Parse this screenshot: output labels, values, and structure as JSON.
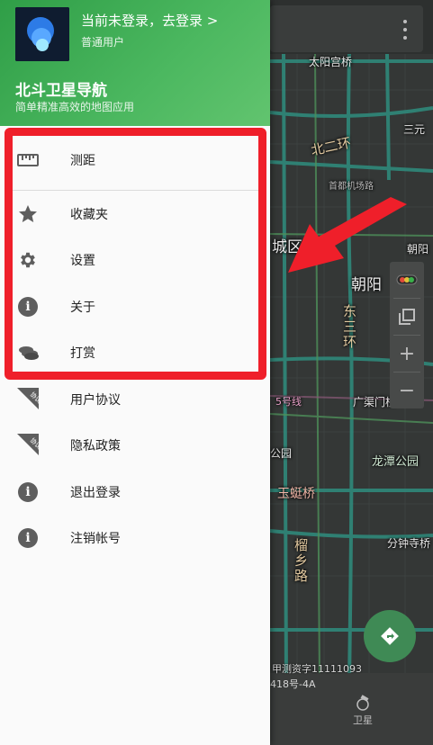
{
  "header": {
    "login_prompt": "当前未登录，去登录 >",
    "user_level": "普通用户",
    "app_name": "北斗卫星导航",
    "app_desc": "简单精准高效的地图应用"
  },
  "menu": {
    "items": [
      {
        "label": "测距",
        "icon": "ruler-icon"
      },
      {
        "label": "收藏夹",
        "icon": "star-icon"
      },
      {
        "label": "设置",
        "icon": "gear-icon"
      },
      {
        "label": "关于",
        "icon": "info-icon"
      },
      {
        "label": "打赏",
        "icon": "coins-icon"
      },
      {
        "label": "用户协议",
        "icon": "agreement-flag-icon",
        "badge": "协议"
      },
      {
        "label": "隐私政策",
        "icon": "privacy-flag-icon",
        "badge": "协议"
      },
      {
        "label": "退出登录",
        "icon": "info-icon"
      },
      {
        "label": "注销帐号",
        "icon": "info-icon"
      }
    ]
  },
  "map": {
    "labels": {
      "taiyanggong": "太阳宫桥",
      "sanyuan": "三元",
      "beiyihuan": "北二环",
      "airport": "首都机场路",
      "chengqu": "城区",
      "chaoyang": "朝阳",
      "chaoyang_small": "朝阳",
      "dongsanhuan": "东三环",
      "guangqumen": "广渠门桥",
      "line5": "5号线",
      "longtan": "龙潭公园",
      "yuting": "玉蜓桥",
      "liuxiang": "榴乡路",
      "fenzhongsi": "分钟寺桥",
      "yuan": "公园"
    },
    "copyright": "甲测资字11111093",
    "copyright2": "418号-4A",
    "sat_tab": "卫星"
  },
  "colors": {
    "drawer_header_start": "#2f9e47",
    "drawer_header_end": "#62c46f",
    "highlight": "#ef1f2a",
    "icon_gray": "#5e5e5e",
    "fab_green": "#3f8a55"
  }
}
